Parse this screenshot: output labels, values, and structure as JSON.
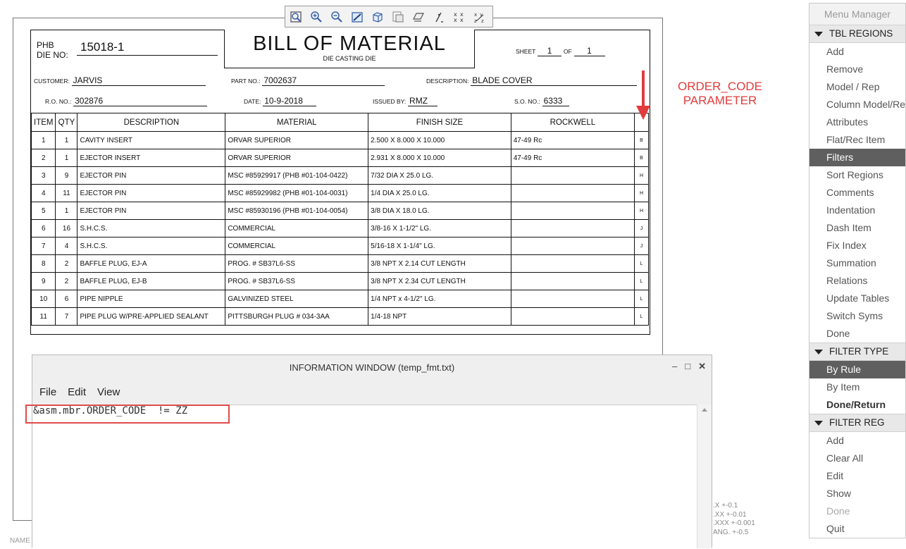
{
  "toolbar": {
    "icons": [
      "zoom-fit-icon",
      "zoom-in-icon",
      "zoom-out-icon",
      "repaint-icon",
      "view-3d-icon",
      "saved-views-icon",
      "orient-icon",
      "annotation-display-icon",
      "axis-display-icon",
      "point-display-icon"
    ]
  },
  "bom": {
    "phb": "PHB",
    "die_no_label": "DIE NO:",
    "die_no": "15018-1",
    "title": "BILL  OF  MATERIAL",
    "subtitle": "DIE CASTING DIE",
    "sheet_label": "SHEET",
    "sheet": "1",
    "of_label": "OF",
    "of": "1",
    "customer_label": "CUSTOMER:",
    "customer": "JARVIS",
    "part_no_label": "PART NO.:",
    "part_no": "7002637",
    "description_label": "DESCRIPTION:",
    "description": "BLADE COVER",
    "ro_label": "R.O. NO.:",
    "ro": "302876",
    "date_label": "DATE:",
    "date": "10-9-2018",
    "issued_label": "ISSUED BY:",
    "issued": "RMZ",
    "so_label": "S.O. NO.:",
    "so": "6333",
    "columns": [
      "ITEM",
      "QTY",
      "DESCRIPTION",
      "MATERIAL",
      "FINISH SIZE",
      "ROCKWELL",
      ""
    ],
    "rows": [
      [
        "1",
        "1",
        "CAVITY INSERT",
        "ORVAR SUPERIOR",
        "2.500 X 8.000 X 10.000",
        "47-49 Rc",
        "B"
      ],
      [
        "2",
        "1",
        "EJECTOR INSERT",
        "ORVAR SUPERIOR",
        "2.931 X 8.000 X 10.000",
        "47-49 Rc",
        "B"
      ],
      [
        "3",
        "9",
        "EJECTOR PIN",
        "MSC #85929917 (PHB #01-104-0422)",
        "7/32 DIA X 25.0 LG.",
        "",
        "H"
      ],
      [
        "4",
        "11",
        "EJECTOR PIN",
        "MSC #85929982 (PHB #01-104-0031)",
        "1/4 DIA X 25.0 LG.",
        "",
        "H"
      ],
      [
        "5",
        "1",
        "EJECTOR PIN",
        "MSC #85930196 (PHB #01-104-0054)",
        "3/8 DIA X 18.0 LG.",
        "",
        "H"
      ],
      [
        "6",
        "16",
        "S.H.C.S.",
        "COMMERCIAL",
        "3/8-16 X 1-1/2\" LG.",
        "",
        "J"
      ],
      [
        "7",
        "4",
        "S.H.C.S.",
        "COMMERCIAL",
        "5/16-18 X 1-1/4\" LG.",
        "",
        "J"
      ],
      [
        "8",
        "2",
        "BAFFLE PLUG, EJ-A",
        "PROG. # SB37L6-SS",
        "3/8 NPT X 2.14 CUT LENGTH",
        "",
        "L"
      ],
      [
        "9",
        "2",
        "BAFFLE PLUG, EJ-B",
        "PROG. # SB37L6-SS",
        "3/8 NPT X 2.34 CUT LENGTH",
        "",
        "L"
      ],
      [
        "10",
        "6",
        "PIPE NIPPLE",
        "GALVINIZED STEEL",
        "1/4 NPT x 4-1/2\" LG.",
        "",
        "L"
      ],
      [
        "11",
        "7",
        "PIPE PLUG W/PRE-APPLIED SEALANT",
        "PITTSBURGH PLUG # 034-3AA",
        "1/4-18 NPT",
        "",
        "L"
      ]
    ]
  },
  "annotation": {
    "line1": "ORDER_CODE",
    "line2": "PARAMETER",
    "color": "#e23b3b"
  },
  "info_window": {
    "title": "INFORMATION  WINDOW (temp_fmt.txt)",
    "minimize": "–",
    "maximize": "□",
    "close": "✕",
    "menu": [
      "File",
      "Edit",
      "View"
    ],
    "code": "&asm.mbr.ORDER_CODE  != ZZ"
  },
  "tolerances": [
    ".X  +-0.1",
    ".XX  +-0.01",
    ".XXX +-0.001",
    "ANG.  +-0.5"
  ],
  "name_fragment": "NAME",
  "menu_manager": {
    "title": "Menu Manager",
    "sections": [
      {
        "header": "TBL REGIONS",
        "items": [
          "Add",
          "Remove",
          "Model / Rep",
          "Column Model/Rep",
          "Attributes",
          "Flat/Rec Item",
          "Filters",
          "Sort Regions",
          "Comments",
          "Indentation",
          "Dash Item",
          "Fix Index",
          "Summation",
          "Relations",
          "Update Tables",
          "Switch Syms",
          "Done"
        ]
      },
      {
        "header": "FILTER TYPE",
        "items": [
          "By Rule",
          "By Item",
          "Done/Return"
        ]
      },
      {
        "header": "FILTER REG",
        "items": [
          "Add",
          "Clear All",
          "Edit",
          "Show",
          "Done",
          "Quit"
        ]
      }
    ],
    "selected": [
      "Filters",
      "By Rule"
    ]
  }
}
